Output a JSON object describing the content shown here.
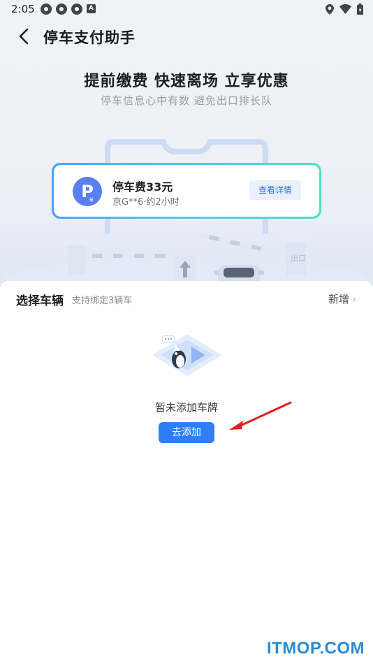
{
  "status_bar": {
    "time": "2:05",
    "badge_letter": "A"
  },
  "header": {
    "title": "停车支付助手",
    "back_icon": "chevron-left-icon"
  },
  "hero": {
    "title": "提前缴费 快速离场 立享优惠",
    "subtitle": "停车信息心中有数 避免出口排长队"
  },
  "fee_card": {
    "icon_letter": "P",
    "icon_sub": "¥",
    "title": "停车费33元",
    "subtitle": "京G**6·约2小时",
    "detail_label": "查看详情"
  },
  "illustration": {
    "exit_sign": "出口"
  },
  "vehicle_panel": {
    "title": "选择车辆",
    "hint": "支持绑定3辆车",
    "add_new_label": "新增",
    "empty_text": "暂未添加车牌",
    "go_add_label": "去添加"
  },
  "watermark": "ITMOP.COM",
  "colors": {
    "primary": "#2f7ef5",
    "p_icon": "#5b7ff0",
    "arrow": "#e11f1f"
  }
}
